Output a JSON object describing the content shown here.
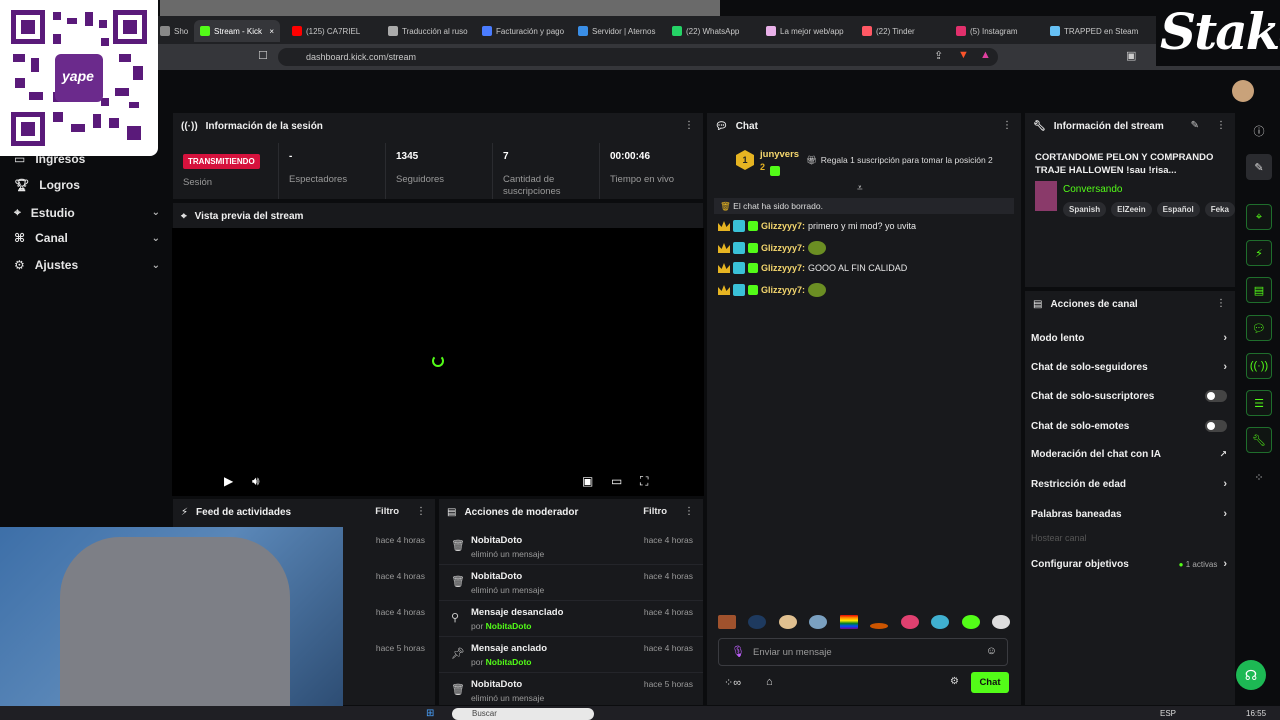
{
  "browser": {
    "tabs": [
      {
        "label": "Shop",
        "color": "#888888"
      },
      {
        "label": "Stream - Kick",
        "color": "#53fc18"
      },
      {
        "label": "(125) CA7RIEL",
        "color": "#ff0000"
      },
      {
        "label": "Traducción al ruso",
        "color": "#aaaaaa"
      },
      {
        "label": "Facturación y pago",
        "color": "#4a7cff"
      },
      {
        "label": "Servidor | Aternos",
        "color": "#3a8ee6"
      },
      {
        "label": "(22) WhatsApp",
        "color": "#25d366"
      },
      {
        "label": "La mejor web/app",
        "color": "#e8b0e8"
      },
      {
        "label": "(22) Tinder",
        "color": "#ff5864"
      },
      {
        "label": "(5) Instagram",
        "color": "#e1306c"
      },
      {
        "label": "TRAPPED en Steam",
        "color": "#66c0f4"
      }
    ],
    "url": "dashboard.kick.com/stream"
  },
  "overlay": {
    "qr_label": "yape",
    "brand": "Stake"
  },
  "sidebar": {
    "items": [
      {
        "label": "Ingresos",
        "icon": "money-icon"
      },
      {
        "label": "Logros",
        "icon": "trophy-icon"
      },
      {
        "label": "Estudio",
        "icon": "studio-icon",
        "chevron": "⌄"
      },
      {
        "label": "Canal",
        "icon": "channel-icon",
        "chevron": "⌄"
      },
      {
        "label": "Ajustes",
        "icon": "gear-icon",
        "chevron": "⌄"
      }
    ]
  },
  "session": {
    "title": "Información de la sesión",
    "live_badge": "TRANSMITIENDO",
    "live_label": "Sesión",
    "stats": [
      {
        "value": "-",
        "label": "Espectadores"
      },
      {
        "value": "1345",
        "label": "Seguidores"
      },
      {
        "value": "7",
        "label": "Cantidad de suscripciones"
      },
      {
        "value": "00:00:46",
        "label": "Tiempo en vivo"
      }
    ]
  },
  "preview": {
    "title": "Vista previa del stream"
  },
  "feed": {
    "title": "Feed de actividades",
    "filter": "Filtro",
    "times": [
      "hace 4 horas",
      "hace 4 horas",
      "hace 4 horas",
      "hace 5 horas"
    ]
  },
  "mod": {
    "title": "Acciones de moderador",
    "filter": "Filtro",
    "rows": [
      {
        "title": "NobitaDoto",
        "sub": "eliminó un mensaje",
        "by": "",
        "time": "hace 4 horas",
        "icon": "trash-icon"
      },
      {
        "title": "NobitaDoto",
        "sub": "eliminó un mensaje",
        "by": "",
        "time": "hace 4 horas",
        "icon": "trash-icon"
      },
      {
        "title": "Mensaje desanclado",
        "sub": "por",
        "by": "NobitaDoto",
        "time": "hace 4 horas",
        "icon": "unpin-icon"
      },
      {
        "title": "Mensaje anclado",
        "sub": "por",
        "by": "NobitaDoto",
        "time": "hace 4 horas",
        "icon": "pin-icon"
      },
      {
        "title": "NobitaDoto",
        "sub": "eliminó un mensaje",
        "by": "",
        "time": "hace 5 horas",
        "icon": "trash-icon"
      }
    ]
  },
  "chat": {
    "title": "Chat",
    "top_user": "junyvers",
    "top_rank": "1",
    "top_count": "2",
    "gift_text": "Regala 1 suscripción para tomar la posición 2",
    "cleared": "El chat ha sido borrado.",
    "messages": [
      {
        "user": "Glizzyyy7:",
        "text": "primero y mi mod? yo uvita",
        "emote": false
      },
      {
        "user": "Glizzyyy7:",
        "text": "",
        "emote": true
      },
      {
        "user": "Glizzyyy7:",
        "text": "GOOO AL FIN CALIDAD",
        "emote": false
      },
      {
        "user": "Glizzyyy7:",
        "text": "",
        "emote": true
      }
    ],
    "input_placeholder": "Enviar un mensaje",
    "send_label": "Chat"
  },
  "stream_info": {
    "title": "Información del stream",
    "stream_title": "CORTANDOME PELON Y COMPRANDO TRAJE HALLOWEN !sau !risa...",
    "category": "Conversando",
    "tags": [
      "Spanish",
      "ElZeein",
      "Español",
      "Feka"
    ]
  },
  "channel_actions": {
    "title": "Acciones de canal",
    "items": [
      {
        "label": "Modo lento",
        "control": "chevron"
      },
      {
        "label": "Chat de solo-seguidores",
        "control": "chevron"
      },
      {
        "label": "Chat de solo-suscriptores",
        "control": "toggle"
      },
      {
        "label": "Chat de solo-emotes",
        "control": "toggle"
      },
      {
        "label": "Moderación del chat con IA",
        "control": "external"
      },
      {
        "label": "Restricción de edad",
        "control": "chevron"
      },
      {
        "label": "Palabras baneadas",
        "control": "chevron"
      },
      {
        "label": "Hostear canal",
        "control": "disabled"
      },
      {
        "label": "Configurar objetivos",
        "control": "chevron",
        "note": "1 activas"
      }
    ]
  },
  "taskbar": {
    "search": "Buscar",
    "lang": "ESP",
    "time": "16:55"
  },
  "colors": {
    "accent": "#53fc18",
    "live": "#d6123d",
    "panel": "#18191c"
  }
}
